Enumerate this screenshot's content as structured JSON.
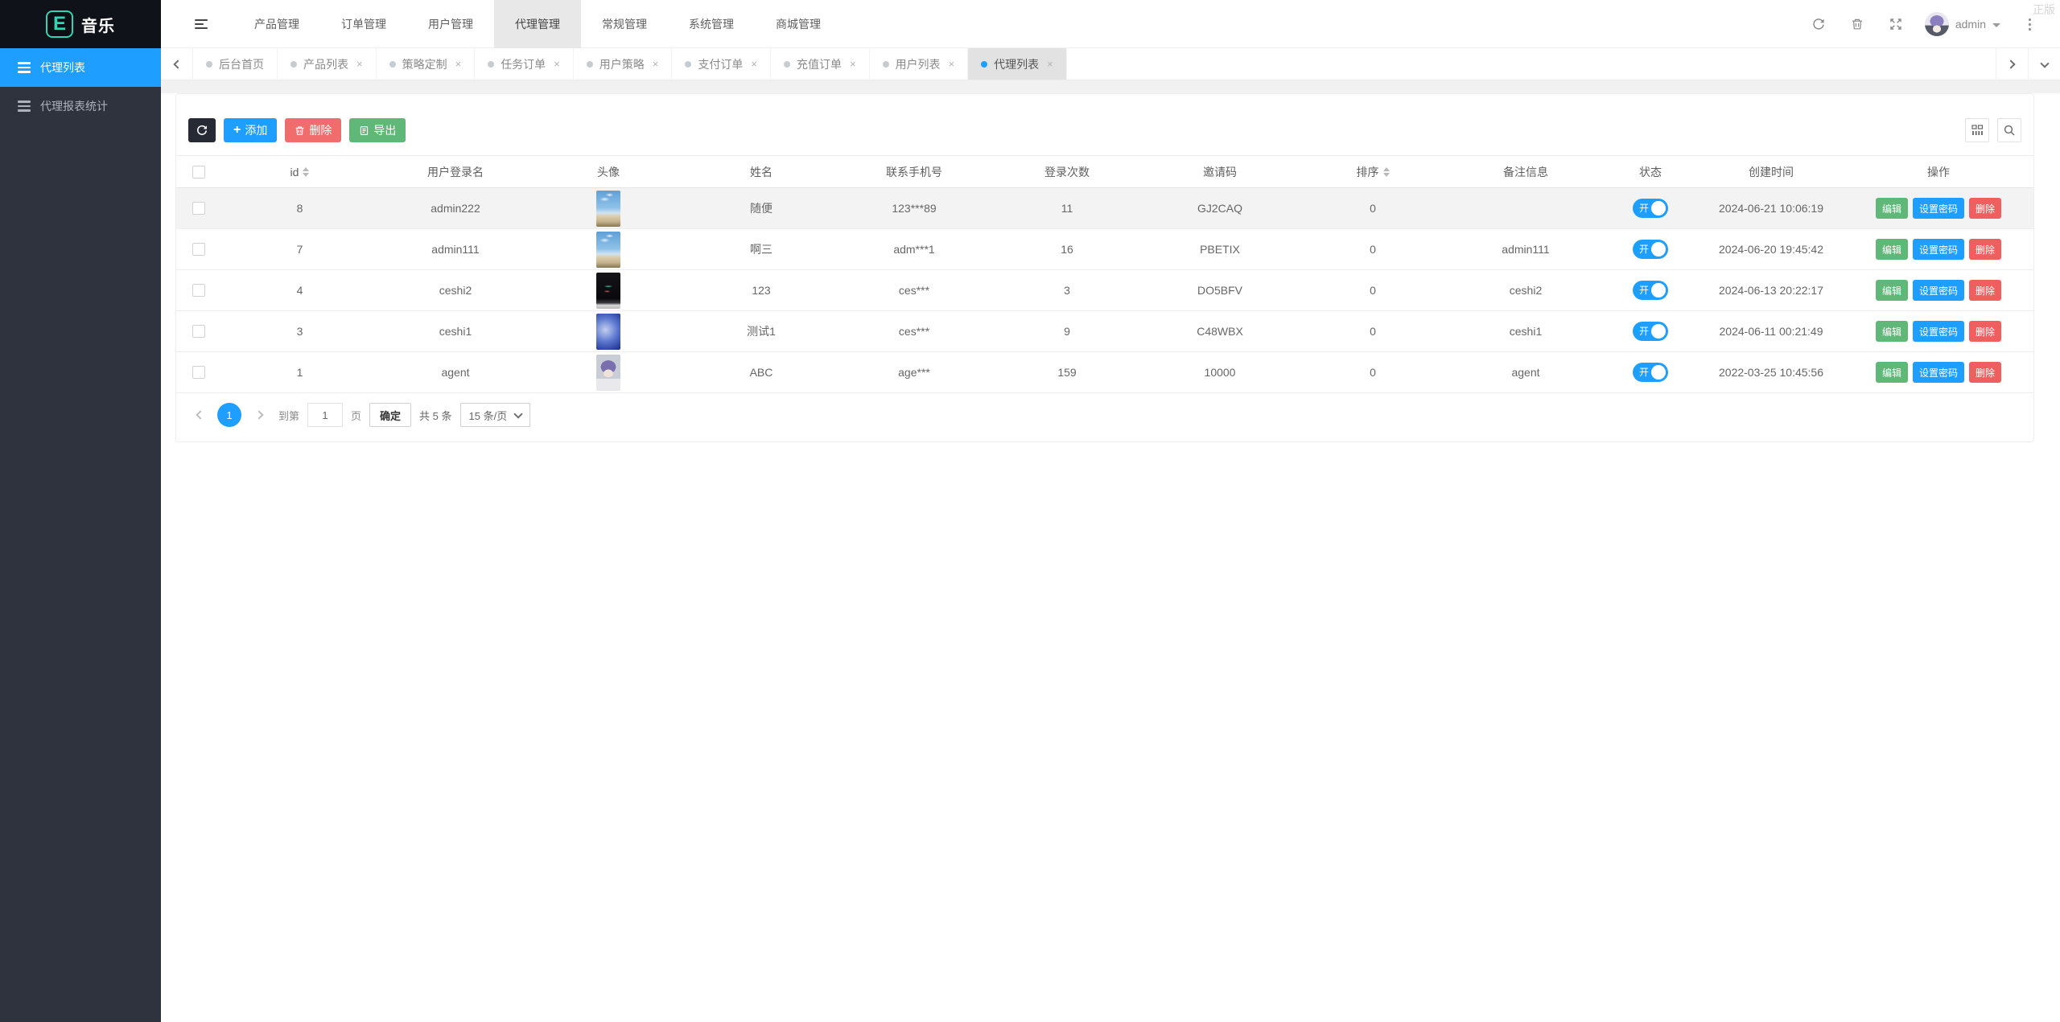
{
  "watermark": "正版",
  "header": {
    "logo_letter": "E",
    "logo_text": "音乐",
    "menu": [
      {
        "label": "产品管理"
      },
      {
        "label": "订单管理"
      },
      {
        "label": "用户管理"
      },
      {
        "label": "代理管理",
        "active": true
      },
      {
        "label": "常规管理"
      },
      {
        "label": "系统管理"
      },
      {
        "label": "商城管理"
      }
    ],
    "user": "admin"
  },
  "sidebar": {
    "items": [
      {
        "label": "代理列表",
        "active": true
      },
      {
        "label": "代理报表统计"
      }
    ]
  },
  "tabs": {
    "items": [
      {
        "label": "后台首页",
        "closable": false
      },
      {
        "label": "产品列表",
        "closable": true
      },
      {
        "label": "策略定制",
        "closable": true
      },
      {
        "label": "任务订单",
        "closable": true
      },
      {
        "label": "用户策略",
        "closable": true
      },
      {
        "label": "支付订单",
        "closable": true
      },
      {
        "label": "充值订单",
        "closable": true
      },
      {
        "label": "用户列表",
        "closable": true
      },
      {
        "label": "代理列表",
        "closable": true,
        "active": true
      }
    ],
    "close_glyph": "×"
  },
  "toolbar": {
    "add_label": "添加",
    "delete_label": "删除",
    "export_label": "导出"
  },
  "table": {
    "columns": [
      "id",
      "用户登录名",
      "头像",
      "姓名",
      "联系手机号",
      "登录次数",
      "邀请码",
      "排序",
      "备注信息",
      "状态",
      "创建时间",
      "操作"
    ],
    "status_on_label": "开",
    "action_labels": {
      "edit": "编辑",
      "set_password": "设置密码",
      "delete": "删除"
    },
    "rows": [
      {
        "id": "8",
        "username": "admin222",
        "avatar": "beach-photo",
        "name": "随便",
        "phone": "123***89",
        "logins": "11",
        "invite": "GJ2CAQ",
        "sort": "0",
        "remark": "",
        "created": "2024-06-21 10:06:19"
      },
      {
        "id": "7",
        "username": "admin111",
        "avatar": "beach-photo",
        "name": "啊三",
        "phone": "adm***1",
        "logins": "16",
        "invite": "PBETIX",
        "sort": "0",
        "remark": "admin111",
        "created": "2024-06-20 19:45:42"
      },
      {
        "id": "4",
        "username": "ceshi2",
        "avatar": "dark-screenshot",
        "name": "123",
        "phone": "ces***",
        "logins": "3",
        "invite": "DO5BFV",
        "sort": "0",
        "remark": "ceshi2",
        "created": "2024-06-13 20:22:17"
      },
      {
        "id": "3",
        "username": "ceshi1",
        "avatar": "blue-gradient",
        "name": "测试1",
        "phone": "ces***",
        "logins": "9",
        "invite": "C48WBX",
        "sort": "0",
        "remark": "ceshi1",
        "created": "2024-06-11 00:21:49"
      },
      {
        "id": "1",
        "username": "agent",
        "avatar": "anime-portrait",
        "name": "ABC",
        "phone": "age***",
        "logins": "159",
        "invite": "10000",
        "sort": "0",
        "remark": "agent",
        "created": "2022-03-25 10:45:56"
      }
    ]
  },
  "pagination": {
    "current_page": "1",
    "goto_label": "到第",
    "goto_value": "1",
    "page_unit": "页",
    "confirm_label": "确定",
    "total_label": "共 5 条",
    "per_page": "15 条/页"
  },
  "colors": {
    "accent": "#1E9FFF",
    "success": "#5FB878",
    "danger": "#F16C6C",
    "sidebar_bg": "#2F333D",
    "logo_bg": "#101219",
    "logo_accent": "#2FD6B5"
  }
}
